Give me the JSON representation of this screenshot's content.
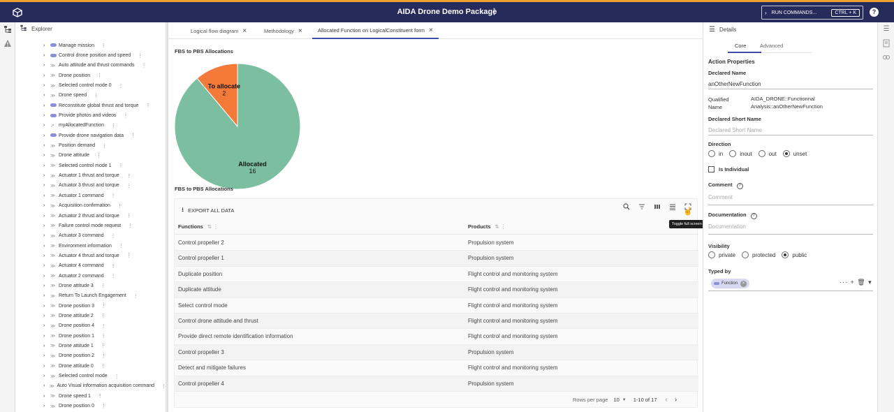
{
  "app": {
    "title": "AIDA Drone Demo Package",
    "kebab": "⋮"
  },
  "command": {
    "chevron": "›",
    "label": "RUN COMMANDS...",
    "shortcut": "CTRL + K"
  },
  "help": "?",
  "explorer": {
    "title": "Explorer",
    "items": [
      {
        "label": "Manage mission",
        "kind": "function"
      },
      {
        "label": "Control drone position and speed",
        "kind": "function"
      },
      {
        "label": "Auto attitude and thrust commands",
        "kind": "flow"
      },
      {
        "label": "Drone position",
        "kind": "flow"
      },
      {
        "label": "Selected control mode 0",
        "kind": "flow"
      },
      {
        "label": "Drone speed",
        "kind": "flow"
      },
      {
        "label": "Reconstitute global thrust and torque",
        "kind": "function"
      },
      {
        "label": "Provide photos and videos",
        "kind": "function"
      },
      {
        "label": "myAllocatedFunction",
        "kind": "allocated"
      },
      {
        "label": "Provide drone navigation data",
        "kind": "function"
      },
      {
        "label": "Position demand",
        "kind": "flow"
      },
      {
        "label": "Drone attitude",
        "kind": "flow"
      },
      {
        "label": "Selected control mode 1",
        "kind": "flow"
      },
      {
        "label": "Actuator 1 thrust and torque",
        "kind": "flow"
      },
      {
        "label": "Actuator 3 thrust and torque",
        "kind": "flow"
      },
      {
        "label": "Actuator 1 command",
        "kind": "flow"
      },
      {
        "label": "Acquisition confirmation",
        "kind": "flow"
      },
      {
        "label": "Actuator 2 thrust and torque",
        "kind": "flow"
      },
      {
        "label": "Failure control mode request",
        "kind": "flow"
      },
      {
        "label": "Actuator 3 command",
        "kind": "flow"
      },
      {
        "label": "Environment information",
        "kind": "flow"
      },
      {
        "label": "Actuator 4 thrust and torque",
        "kind": "flow"
      },
      {
        "label": "Actuator 4 command",
        "kind": "flow"
      },
      {
        "label": "Actuator 2 command",
        "kind": "flow"
      },
      {
        "label": "Drone attitude 3",
        "kind": "flow"
      },
      {
        "label": "Return To Launch Engagement",
        "kind": "flow"
      },
      {
        "label": "Drone position 3",
        "kind": "flow"
      },
      {
        "label": "Drone attitude 2",
        "kind": "flow"
      },
      {
        "label": "Drone position 4",
        "kind": "flow"
      },
      {
        "label": "Drone position 1",
        "kind": "flow"
      },
      {
        "label": "Drone attitude 1",
        "kind": "flow"
      },
      {
        "label": "Drone position 2",
        "kind": "flow"
      },
      {
        "label": "Drone attitude 0",
        "kind": "flow"
      },
      {
        "label": "Selected control mode",
        "kind": "flow"
      },
      {
        "label": "Auto Visual information acquisition command",
        "kind": "flow"
      },
      {
        "label": "Drone speed 1",
        "kind": "flow"
      },
      {
        "label": "Drone position 0",
        "kind": "flow"
      }
    ]
  },
  "tabs": [
    {
      "label": "Logical flow diagram",
      "active": false
    },
    {
      "label": "Methodology",
      "active": false
    },
    {
      "label": "Allocated Function on LogicalConstituent form",
      "active": true
    }
  ],
  "chart_data": {
    "type": "pie",
    "title": "FBS to PBS Allocations",
    "slices": [
      {
        "label": "Allocated",
        "value": 16,
        "color": "#7bbfa0"
      },
      {
        "label": "To allocate",
        "value": 2,
        "color": "#f47a3a"
      }
    ]
  },
  "table": {
    "title": "FBS to PBS Allocations",
    "export_label": "EXPORT ALL DATA",
    "tooltip": "Toggle full screen",
    "columns": [
      "Functions",
      "Products"
    ],
    "rows": [
      [
        "Control propeller 2",
        "Propulsion system"
      ],
      [
        "Control propeller 1",
        "Propulsion system"
      ],
      [
        "Duplicate position",
        "Flight control and monitoring system"
      ],
      [
        "Duplicate attitude",
        "Flight control and monitoring system"
      ],
      [
        "Select control mode",
        "Flight control and monitoring system"
      ],
      [
        "Control drone attitude and thrust",
        "Flight control and monitoring system"
      ],
      [
        "Provide direct remote identification information",
        "Flight control and monitoring system"
      ],
      [
        "Control propeller 3",
        "Propulsion system"
      ],
      [
        "Detect and mitigate failures",
        "Flight control and monitoring system"
      ],
      [
        "Control propeller 4",
        "Propulsion system"
      ]
    ],
    "pagination": {
      "rows_per_page_label": "Rows per page",
      "rows_per_page": "10",
      "range": "1-10 of 17"
    }
  },
  "details": {
    "title": "Details",
    "tabs": [
      "Core",
      "Advanced"
    ],
    "section": "Action Properties",
    "declared_name_label": "Declared Name",
    "declared_name": "anOtherNewFunction",
    "qualified_label_1": "Qualified",
    "qualified_label_2": "Name",
    "qualified_value_1": "AIDA_DRONE::Functionnal",
    "qualified_value_2": "Analysis::anOtherNewFunction",
    "short_name_label": "Declared Short Name",
    "short_name_placeholder": "Declared Short Name",
    "direction_label": "Direction",
    "direction_options": [
      "in",
      "inout",
      "out",
      "unset"
    ],
    "direction_selected": "unset",
    "individual_label": "Is Individual",
    "comment_label": "Comment",
    "comment_placeholder": "Comment",
    "documentation_label": "Documentation",
    "documentation_placeholder": "Documentation",
    "visibility_label": "Visibility",
    "visibility_options": [
      "private",
      "protected",
      "public"
    ],
    "visibility_selected": "public",
    "typed_by_label": "Typed by",
    "typed_by_chip": "Function",
    "typed_by_actions": "··· + 🗑 ▾"
  }
}
